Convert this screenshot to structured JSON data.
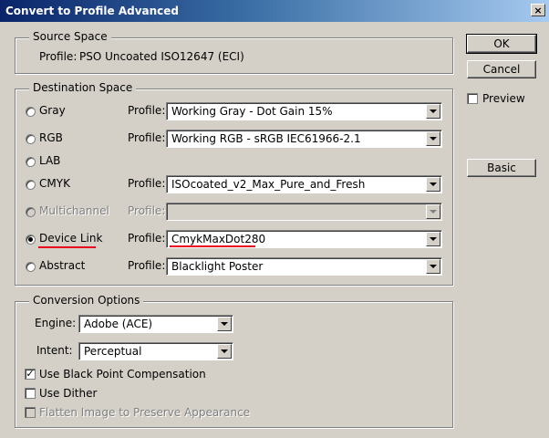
{
  "window": {
    "title": "Convert to Profile Advanced",
    "close_glyph": "×"
  },
  "source_space": {
    "legend": "Source Space",
    "profile_label": "Profile:",
    "profile_value": "PSO Uncoated ISO12647 (ECI)"
  },
  "destination_space": {
    "legend": "Destination Space",
    "profile_label": "Profile:",
    "options": [
      {
        "label": "Gray",
        "profile": "Working Gray - Dot Gain 15%",
        "selected": false,
        "enabled": true
      },
      {
        "label": "RGB",
        "profile": "Working RGB - sRGB IEC61966-2.1",
        "selected": false,
        "enabled": true
      },
      {
        "label": "LAB",
        "profile": "",
        "selected": false,
        "enabled": true
      },
      {
        "label": "CMYK",
        "profile": "ISOcoated_v2_Max_Pure_and_Fresh",
        "selected": false,
        "enabled": true
      },
      {
        "label": "Multichannel",
        "profile": "",
        "selected": false,
        "enabled": false
      },
      {
        "label": "Device Link",
        "profile": "CmykMaxDot280",
        "selected": true,
        "enabled": true
      },
      {
        "label": "Abstract",
        "profile": "Blacklight Poster",
        "selected": false,
        "enabled": true
      }
    ],
    "highlight_color": "#e8001c"
  },
  "conversion_options": {
    "legend": "Conversion Options",
    "engine_label": "Engine:",
    "engine_value": "Adobe (ACE)",
    "intent_label": "Intent:",
    "intent_value": "Perceptual",
    "black_point_label": "Use Black Point Compensation",
    "black_point_checked": true,
    "dither_label": "Use Dither",
    "dither_checked": false,
    "flatten_label": "Flatten Image to Preserve Appearance",
    "flatten_checked": false,
    "flatten_enabled": false
  },
  "buttons": {
    "ok": "OK",
    "cancel": "Cancel",
    "preview_label": "Preview",
    "preview_checked": false,
    "basic": "Basic"
  },
  "colors": {
    "dialog_bg": "#d4d0c8",
    "titlebar_start": "#0a246a",
    "titlebar_end": "#a6caf0"
  }
}
